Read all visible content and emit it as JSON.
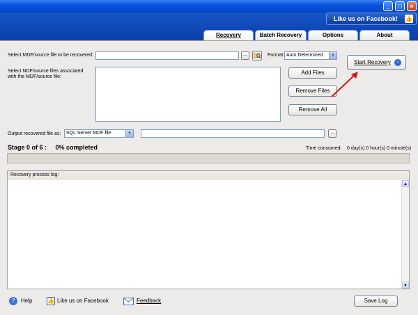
{
  "window": {
    "minimize": "_",
    "maximize": "□",
    "close": "×"
  },
  "header": {
    "facebook_like": "Like us on Facebook!",
    "thumb_glyph": "👍"
  },
  "tabs": [
    {
      "label": "Recovery"
    },
    {
      "label": "Batch Recovery"
    },
    {
      "label": "Options"
    },
    {
      "label": "About"
    }
  ],
  "recovery": {
    "source_label": "Select MDF/source file to be recovered:",
    "source_value": "",
    "browse": "...",
    "format_label": "Format:",
    "format_value": "Auto Determined",
    "assoc_label_1": "Select NDF/source files associated",
    "assoc_label_2": "with the MDF/source file:",
    "add_files": "Add Files",
    "remove_files": "Remove Files",
    "remove_all": "Remove All",
    "start_recovery": "Start Recovery",
    "output_label": "Output recovered file as:",
    "output_type": "SQL Server MDF file",
    "output_value": "",
    "stage": "Stage 0 of 6 :",
    "percent": "0% completed",
    "time_label": "Time consumed:",
    "time_value": "0 day(s) 0 hour(s) 0 minute(s)",
    "progress": 0,
    "log_title": "Recovery process log:"
  },
  "footer": {
    "help": "Help",
    "like": "Like us on Facebook",
    "feedback": "Feedback",
    "save_log": "Save Log"
  },
  "colors": {
    "title_bar": "#0a56e0",
    "header": "#1656c8",
    "panel": "#ecebea",
    "arrow": "#d01818"
  }
}
